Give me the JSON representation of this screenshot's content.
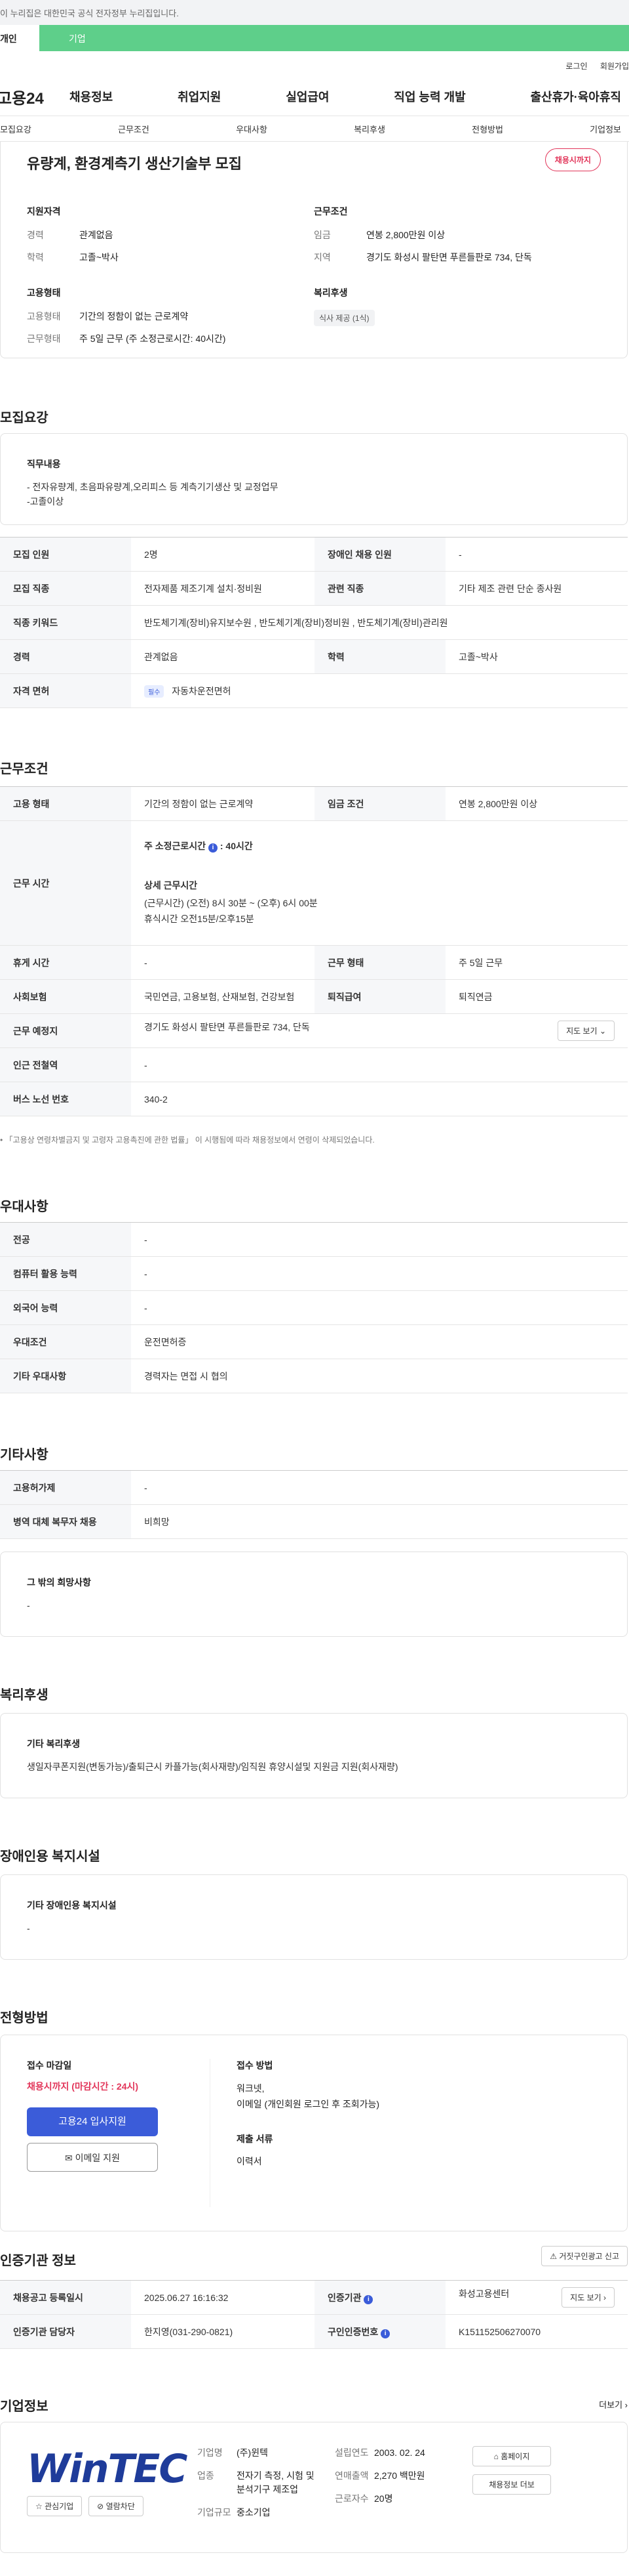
{
  "gov_bar": {
    "text": "이 누리집은 대한민국 공식 전자정부 누리집입니다."
  },
  "tabs": {
    "personal": "개인",
    "company": "기업"
  },
  "util": {
    "login": "로그인",
    "join": "회원가입"
  },
  "gnb": {
    "logo": "고용24",
    "menu": [
      "채용정보",
      "취업지원",
      "실업급여",
      "직업 능력 개발",
      "출산휴가·육아휴직"
    ]
  },
  "snb": [
    "모집요강",
    "근무조건",
    "우대사항",
    "복리후생",
    "전형방법",
    "기업정보"
  ],
  "job": {
    "title": "유량계, 환경계측기 생산기술부 모집",
    "badge": "채용시까지",
    "qual_label": "지원자격",
    "career_k": "경력",
    "career_v": "관계없음",
    "edu_k": "학력",
    "edu_v": "고졸~박사",
    "cond_label": "근무조건",
    "wage_k": "임금",
    "wage_v": "연봉 2,800만원 이상",
    "region_k": "지역",
    "region_v": "경기도 화성시 팔탄면 푸른들판로 734, 단독",
    "emp_label": "고용형태",
    "emptype_k": "고용형태",
    "emptype_v": "기간의 정함이 없는 근로계약",
    "worktype_k": "근무형태",
    "worktype_v": "주 5일 근무 (주 소정근로시간: 40시간)",
    "welfare_label": "복리후생",
    "welfare_chip": "식사 제공 (1식)"
  },
  "recruit": {
    "heading": "모집요강",
    "duty_title": "직무내용",
    "duty_line1": "- 전자유량계, 초음파유량계,오리피스 등 계측기기생산 및 교정업무",
    "duty_line2": "-고졸이상",
    "rows": {
      "headcount_k": "모집 인원",
      "headcount_v": "2명",
      "disabled_k": "장애인 채용 인원",
      "disabled_v": "-",
      "job_k": "모집 직종",
      "job_v": "전자제품 제조기계 설치·정비원",
      "related_k": "관련 직종",
      "related_v": "기타 제조 관련 단순 종사원",
      "keyword_k": "직종 키워드",
      "keyword_v": "반도체기계(장비)유지보수원 , 반도체기계(장비)정비원 , 반도체기계(장비)관리원",
      "career_k": "경력",
      "career_v": "관계없음",
      "edu_k": "학력",
      "edu_v": "고졸~박사",
      "license_k": "자격 면허",
      "license_tag": "필수",
      "license_v": "자동차운전면허"
    }
  },
  "conditions": {
    "heading": "근무조건",
    "emptype_k": "고용 형태",
    "emptype_v": "기간의 정함이 없는 근로계약",
    "wage_k": "임금 조건",
    "wage_v": "연봉 2,800만원 이상",
    "hours_k": "근무 시간",
    "hours_weekly": "주 소정근로시간",
    "hours_weekly_v": "40시간",
    "hours_detail_title": "상세 근무시간",
    "hours_detail_line1": "(근무시간) (오전) 8시 30분 ~ (오후) 6시 00분",
    "hours_detail_line2": "휴식시간 오전15분/오후15분",
    "holiday_k": "휴게 시간",
    "holiday_v": "-",
    "worktype_k": "근무 형태",
    "worktype_v": "주 5일 근무",
    "insurance_k": "사회보험",
    "insurance_v": "국민연금, 고용보험, 산재보험, 건강보험",
    "retire_k": "퇴직급여",
    "retire_v": "퇴직연금",
    "location_k": "근무 예정지",
    "location_v": "경기도 화성시 팔탄면 푸른들판로 734, 단독",
    "map_btn": "지도 보기",
    "subway_k": "인근 전철역",
    "subway_v": "-",
    "bus_k": "버스 노선 번호",
    "bus_v": "340-2",
    "note": "「고용상 연령차별금지 및 고령자 고용촉진에 관한 법률」 이 시행됨에 따라 채용정보에서 연령이 삭제되었습니다."
  },
  "preferences": {
    "heading": "우대사항",
    "major_k": "전공",
    "major_v": "-",
    "computer_k": "컴퓨터 활용 능력",
    "computer_v": "-",
    "language_k": "외국어 능력",
    "language_v": "-",
    "pref_k": "우대조건",
    "pref_v": "운전면허증",
    "etc_k": "기타 우대사항",
    "etc_v": "경력자는 면접 시 협의"
  },
  "others": {
    "heading": "기타사항",
    "permit_k": "고용허가제",
    "permit_v": "-",
    "military_k": "병역 대체 복무자 채용",
    "military_v": "비희망",
    "hope_title": "그 밖의 희망사항",
    "hope_v": "-"
  },
  "welfare": {
    "heading": "복리후생",
    "title": "기타 복리후생",
    "body": "생일자쿠폰지원(변동가능)/출퇴근시 카플가능(회사재량)/임직원 휴양시설및 지원금 지원(회사재량)"
  },
  "disability": {
    "heading": "장애인용 복지시설",
    "title": "기타 장애인용 복지시설",
    "body": "-"
  },
  "selection": {
    "heading": "전형방법",
    "deadline_title": "접수 마감일",
    "deadline_v": "채용시까지 (마감시간 : 24시)",
    "apply_btn": "고용24 입사지원",
    "email_btn": "이메일 지원",
    "method_title": "접수 방법",
    "method_line1": "워크넷,",
    "method_line2": "이메일 (개인회원 로그인 후 조회가능)",
    "docs_title": "제출 서류",
    "docs_v": "이력서"
  },
  "cert": {
    "heading": "인증기관 정보",
    "report_btn": "거짓구인광고 신고",
    "regdate_k": "채용공고 등록일시",
    "regdate_v": "2025.06.27 16:16:32",
    "agency_k": "인증기관",
    "agency_v": "화성고용센터",
    "map_btn": "지도 보기",
    "manager_k": "인증기관 담당자",
    "manager_v": "한지영(031-290-0821)",
    "certno_k": "구인인증번호",
    "certno_v": "K151152506270070"
  },
  "company": {
    "heading": "기업정보",
    "more": "더보기",
    "logo_text": "WinTEC",
    "fav_btn": "관심기업",
    "block_btn": "열람차단",
    "name_k": "기업명",
    "name_v": "(주)윈텍",
    "industry_k": "업종",
    "industry_v": "전자기 측정, 시험 및 분석기구 제조업",
    "size_k": "기업규모",
    "size_v": "중소기업",
    "year_k": "설립연도",
    "year_v": "2003. 02. 24",
    "revenue_k": "연매출액",
    "revenue_v": "2,270 백만원",
    "employees_k": "근로자수",
    "employees_v": "20명",
    "homepage_btn": "홈페이지",
    "jobs_btn": "채용정보 더보"
  }
}
